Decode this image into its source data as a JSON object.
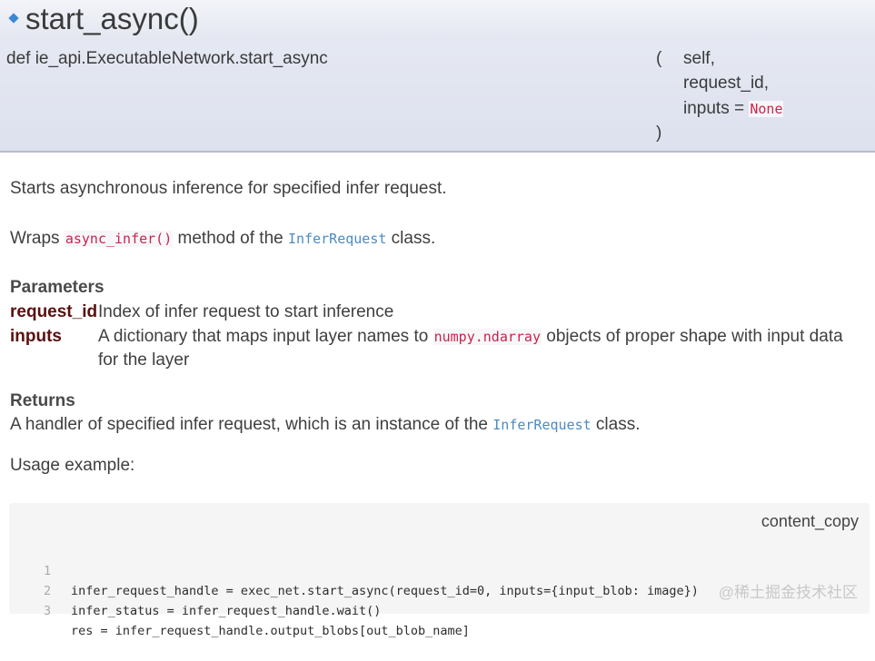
{
  "header": {
    "title": "start_async()",
    "signature_def": "def ie_api.ExecutableNetwork.start_async",
    "open_paren": "(",
    "close_paren": ")",
    "params": {
      "p1": "self,",
      "p2": "request_id,",
      "p3_name": "inputs =",
      "p3_default": "None"
    }
  },
  "description": {
    "summary": "Starts asynchronous inference for specified infer request.",
    "wraps_prefix": "Wraps",
    "wraps_method": "async_infer()",
    "wraps_middle": "method of the",
    "wraps_class": "InferRequest",
    "wraps_suffix": "class."
  },
  "parameters": {
    "heading": "Parameters",
    "items": [
      {
        "name": "request_id",
        "desc": "Index of infer request to start inference"
      },
      {
        "name": "inputs",
        "desc_prefix": "A dictionary that maps input layer names to",
        "desc_code": "numpy.ndarray",
        "desc_suffix": "objects of proper shape with input data",
        "desc_line2": "for the layer"
      }
    ]
  },
  "returns": {
    "heading": "Returns",
    "prefix": "A handler of specified infer request, which is an instance of the",
    "class": "InferRequest",
    "suffix": "class."
  },
  "usage": {
    "label": "Usage example:",
    "copy_label": "content_copy",
    "lines": [
      {
        "num": "1",
        "code": "infer_request_handle = exec_net.start_async(request_id=0, inputs={input_blob: image})"
      },
      {
        "num": "2",
        "code": "infer_status = infer_request_handle.wait()"
      },
      {
        "num": "3",
        "code": "res = infer_request_handle.output_blobs[out_blob_name]"
      }
    ]
  },
  "watermark": "@稀土掘金技术社区"
}
